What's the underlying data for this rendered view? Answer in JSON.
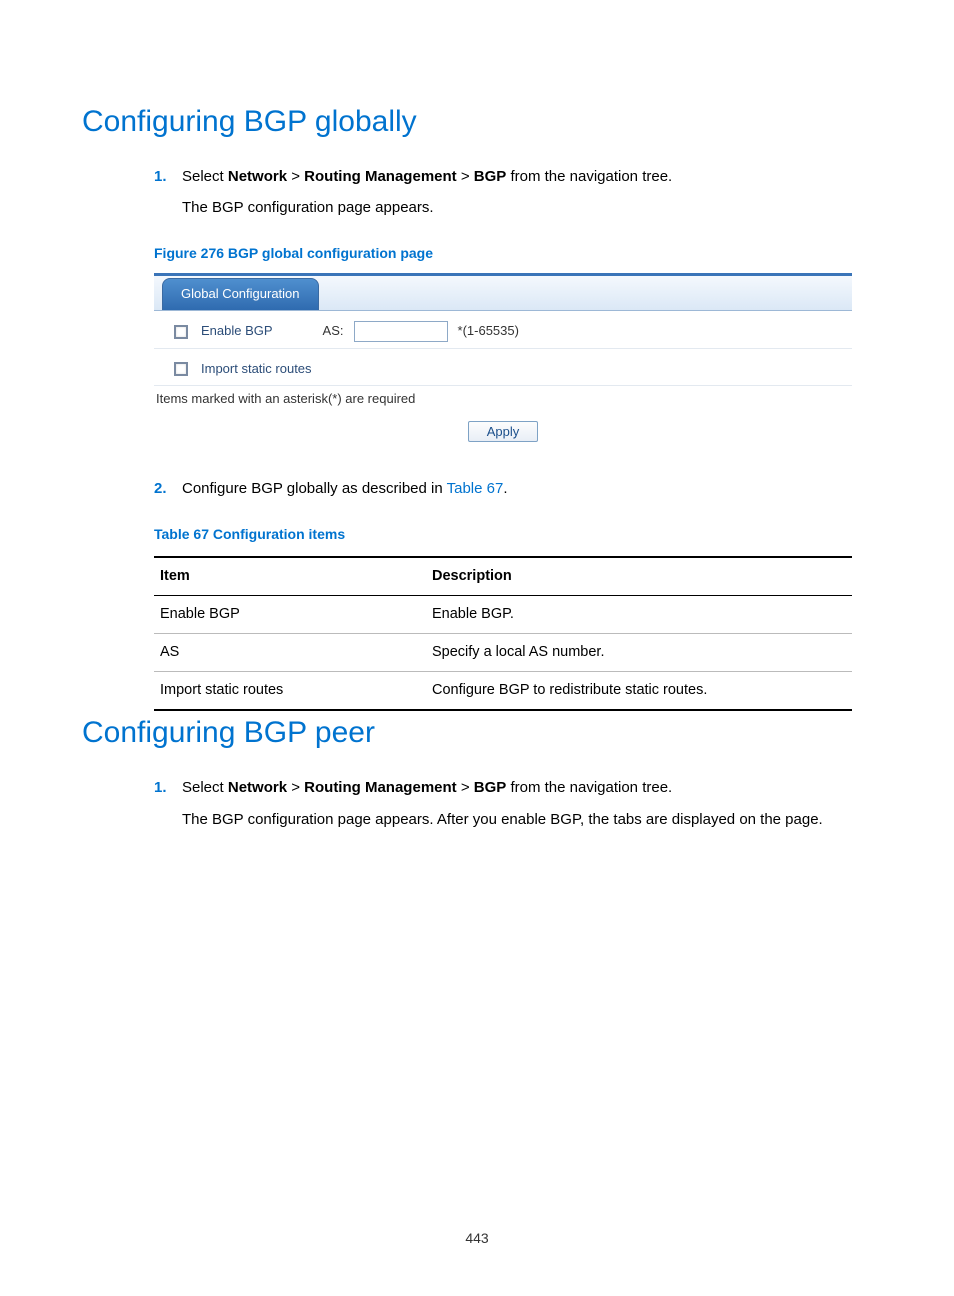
{
  "page_number": "443",
  "section1": {
    "title": "Configuring BGP globally",
    "steps": [
      {
        "num": "1.",
        "before": "Select ",
        "b1": "Network",
        "gt1": " > ",
        "b2": "Routing Management",
        "gt2": " > ",
        "b3": "BGP",
        "after": " from the navigation tree.",
        "sub": "The BGP configuration page appears."
      },
      {
        "num": "2.",
        "before": "Configure BGP globally as described in ",
        "link": "Table 67",
        "after": "."
      }
    ],
    "figure_caption": "Figure 276 BGP global configuration page",
    "table_caption": "Table 67 Configuration items"
  },
  "figure": {
    "tab_label": "Global Configuration",
    "enable_label": "Enable BGP",
    "as_label": "AS:",
    "as_hint": "*(1-65535)",
    "import_label": "Import static routes",
    "required_note": "Items marked with an asterisk(*) are required",
    "apply_label": "Apply"
  },
  "table": {
    "headers": {
      "item": "Item",
      "desc": "Description"
    },
    "rows": [
      {
        "item": "Enable BGP",
        "desc": "Enable BGP."
      },
      {
        "item": "AS",
        "desc": "Specify a local AS number."
      },
      {
        "item": "Import static routes",
        "desc": "Configure BGP to redistribute static routes."
      }
    ]
  },
  "section2": {
    "title": "Configuring BGP peer",
    "steps": [
      {
        "num": "1.",
        "before": "Select ",
        "b1": "Network",
        "gt1": " > ",
        "b2": "Routing Management",
        "gt2": " > ",
        "b3": "BGP",
        "after": " from the navigation tree.",
        "sub": "The BGP configuration page appears. After you enable BGP, the tabs are displayed on the page."
      }
    ]
  }
}
